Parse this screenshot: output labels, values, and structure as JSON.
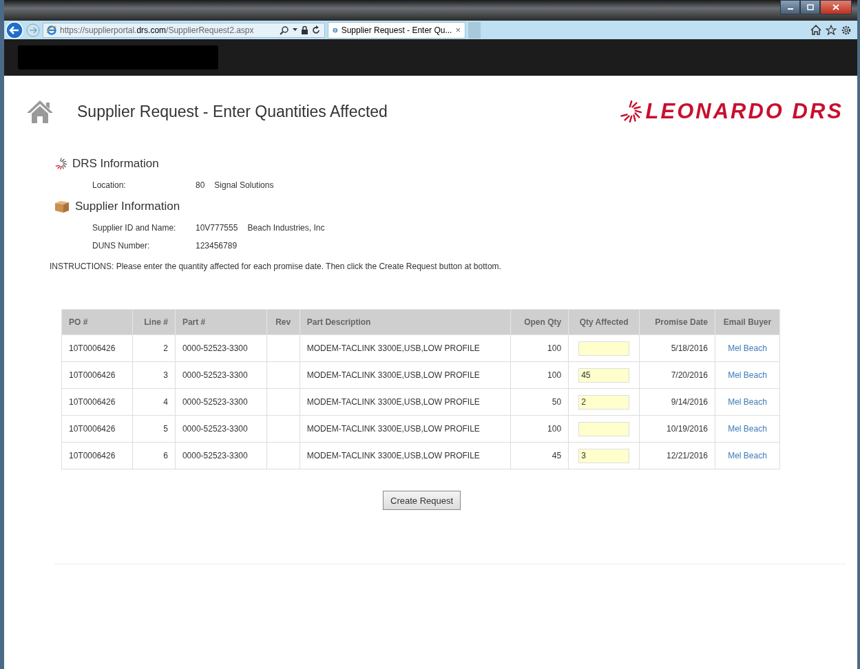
{
  "browser": {
    "url": "https://supplierportal.**drs.com**/SupplierRequest2.aspx",
    "tab_title": "Supplier Request - Enter Qu...",
    "tab_close": "×"
  },
  "header": {
    "title": "Supplier Request - Enter Quantities Affected",
    "logo_text": "LEONARDO DRS"
  },
  "drs_section": {
    "heading": "DRS Information",
    "fields": [
      {
        "label": "Location:",
        "values": [
          "80",
          "Signal Solutions"
        ]
      }
    ]
  },
  "supplier_section": {
    "heading": "Supplier Information",
    "fields": [
      {
        "label": "Supplier ID and Name:",
        "values": [
          "10V777555",
          "Beach Industries, Inc"
        ]
      },
      {
        "label": "DUNS Number:",
        "values": [
          "123456789"
        ]
      }
    ]
  },
  "instructions": "INSTRUCTIONS:  Please enter the quantity affected for each promise date. Then click the Create Request button at bottom.",
  "table": {
    "columns": [
      "PO #",
      "Line #",
      "Part #",
      "Rev",
      "Part Description",
      "Open Qty",
      "Qty Affected",
      "Promise Date",
      "Email Buyer"
    ],
    "rows": [
      {
        "po": "10T0006426",
        "line": "2",
        "part": "0000-52523-3300",
        "description": "MODEM-TACLINK 3300E,USB,LOW PROFILE",
        "open_qty": "100",
        "promise_date": "5/18/2016",
        "buyer": "Mel Beach"
      },
      {
        "po": "10T0006426",
        "line": "3",
        "part": "0000-52523-3300",
        "description": "MODEM-TACLINK 3300E,USB,LOW PROFILE",
        "open_qty": "100",
        "qty_affected": "45",
        "promise_date": "7/20/2016",
        "buyer": "Mel Beach"
      },
      {
        "po": "10T0006426",
        "line": "4",
        "part": "0000-52523-3300",
        "description": "MODEM-TACLINK 3300E,USB,LOW PROFILE",
        "open_qty": "50",
        "qty_affected": "2",
        "promise_date": "9/14/2016",
        "buyer": "Mel Beach"
      },
      {
        "po": "10T0006426",
        "line": "5",
        "part": "0000-52523-3300",
        "description": "MODEM-TACLINK 3300E,USB,LOW PROFILE",
        "open_qty": "100",
        "promise_date": "10/19/2016",
        "buyer": "Mel Beach"
      },
      {
        "po": "10T0006426",
        "line": "6",
        "part": "0000-52523-3300",
        "description": "MODEM-TACLINK 3300E,USB,LOW PROFILE",
        "open_qty": "45",
        "qty_affected": "3",
        "promise_date": "12/21/2016",
        "buyer": "Mel Beach"
      }
    ]
  },
  "button": "Create Request"
}
